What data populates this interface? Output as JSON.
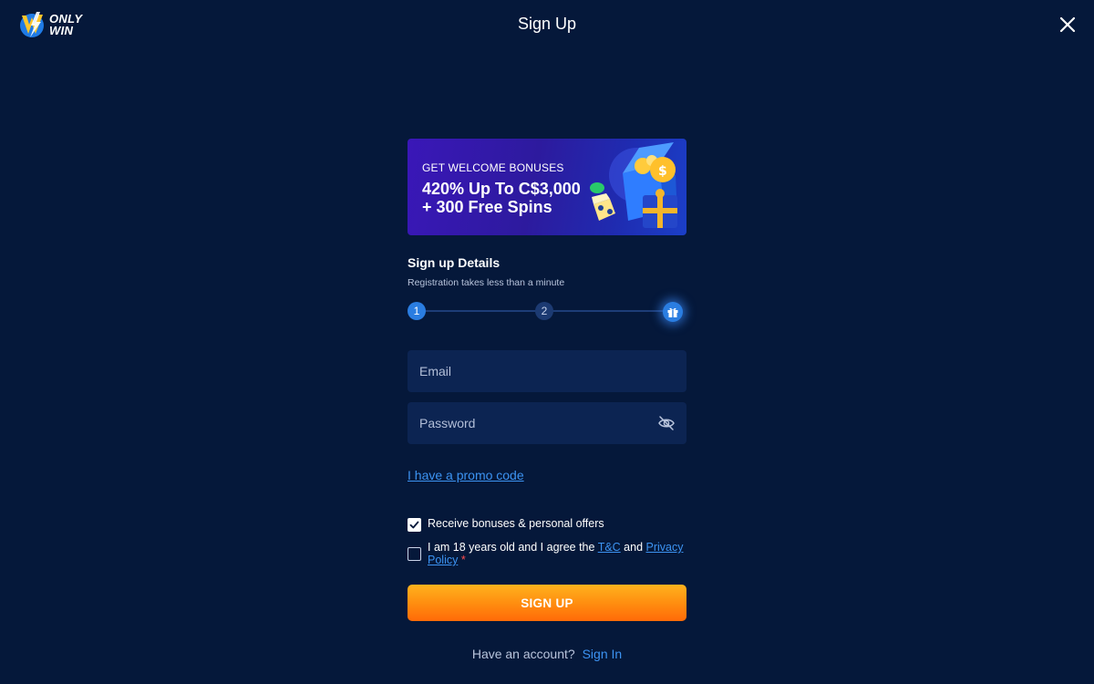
{
  "header": {
    "logo_line1": "ONLY",
    "logo_line2": "WIN",
    "title": "Sign Up"
  },
  "banner": {
    "kicker": "GET WELCOME BONUSES",
    "headline_line1": "420% Up To C$3,000",
    "headline_line2": "+ 300 Free Spins"
  },
  "details": {
    "title": "Sign up Details",
    "subtitle": "Registration takes less than a minute"
  },
  "stepper": {
    "step1": "1",
    "step2": "2",
    "current_step": 1
  },
  "form": {
    "email_placeholder": "Email",
    "password_placeholder": "Password",
    "promo_link": "I have a promo code",
    "bonus_label": "Receive bonuses & personal offers",
    "bonus_checked": true,
    "agree_prefix": "I am 18 years old and I agree the ",
    "tc_link": "T&C",
    "agree_and": " and ",
    "privacy_link": "Privacy Policy",
    "required_mark": "*",
    "agree_checked": false,
    "submit_label": "SIGN UP"
  },
  "footer": {
    "have_account": "Have an account?",
    "signin_link": "Sign In"
  },
  "colors": {
    "background": "#05183a",
    "field": "#0c2452",
    "link": "#3c93f2",
    "cta_top": "#ffb21d",
    "cta_bottom": "#ff6a08"
  }
}
